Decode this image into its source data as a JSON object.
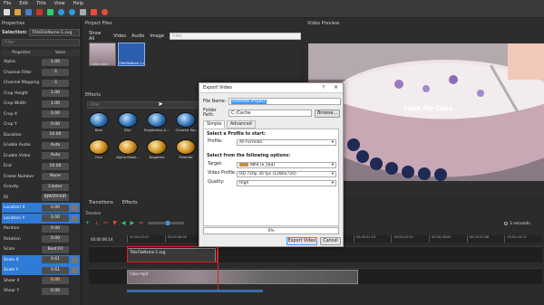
{
  "menu": [
    "File",
    "Edit",
    "Title",
    "View",
    "Help"
  ],
  "colors": {
    "accent": "#2f7bd8",
    "dialog_bg": "#ececec",
    "playhead": "#e02020"
  },
  "properties": {
    "title": "Properties",
    "selection_label": "Selection:",
    "selection_value": "TitleFileName-1.svg",
    "filter_placeholder": "Filter",
    "col_properties": "Properties",
    "col_value": "Value",
    "rows": [
      {
        "name": "Alpha",
        "value": "1.00"
      },
      {
        "name": "Channel Filter",
        "value": "-1"
      },
      {
        "name": "Channel Mapping",
        "value": "-1"
      },
      {
        "name": "Crop Height",
        "value": "1.00"
      },
      {
        "name": "Crop Width",
        "value": "1.00"
      },
      {
        "name": "Crop X",
        "value": "0.00"
      },
      {
        "name": "Crop Y",
        "value": "0.00"
      },
      {
        "name": "Duration",
        "value": "10.00"
      },
      {
        "name": "Enable Audio",
        "value": "Auto"
      },
      {
        "name": "Enable Video",
        "value": "Auto"
      },
      {
        "name": "End",
        "value": "10.00"
      },
      {
        "name": "Frame Number",
        "value": "None"
      },
      {
        "name": "Gravity",
        "value": "Center"
      },
      {
        "name": "ID",
        "value": "BJWDYOUR"
      },
      {
        "name": "Location X",
        "value": "0.00"
      },
      {
        "name": "Location Y",
        "value": "0.00"
      },
      {
        "name": "Position",
        "value": "0.00"
      },
      {
        "name": "Rotation",
        "value": "0.00"
      },
      {
        "name": "Scale",
        "value": "Best Fit"
      },
      {
        "name": "Scale X",
        "value": "0.61"
      },
      {
        "name": "Scale Y",
        "value": "0.61"
      },
      {
        "name": "Shear X",
        "value": "0.00"
      },
      {
        "name": "Shear Y",
        "value": "0.00"
      }
    ]
  },
  "project_files": {
    "title": "Project Files",
    "tabs": [
      "Show All",
      "Video",
      "Audio",
      "Image"
    ],
    "filter_placeholder": "Filter",
    "files": [
      "Cake.mp4",
      "TitleFileName-1.svg"
    ]
  },
  "effects": {
    "title": "Effects",
    "filter_placeholder": "Filter",
    "items": [
      "Bars",
      "Blur",
      "Brightness &...",
      "Chroma Key",
      "Hue",
      "Alpha Mask...",
      "Negative",
      "Pixelate"
    ]
  },
  "preview": {
    "title": "Video Preview",
    "overlay_text": "Time for Cake"
  },
  "export_dialog": {
    "title": "Export Video",
    "help": "?",
    "close": "×",
    "file_name_label": "File Name:",
    "file_name_value": "Untitled Project",
    "folder_label": "Folder Path:",
    "folder_value": "C:/Cache",
    "browse": "Browse...",
    "tab_simple": "Simple",
    "tab_advanced": "Advanced",
    "profile_section": "Select a Profile to start:",
    "profile_label": "Profile:",
    "profile_value": "All Formats",
    "options_section": "Select from the following options:",
    "target_label": "Target:",
    "target_value": "MP4 (h.264)",
    "video_profile_label": "Video Profile:",
    "video_profile_value": "HD 720p 30 fps (1280x720)",
    "quality_label": "Quality:",
    "quality_value": "High",
    "progress_text": "0%",
    "progress": 0,
    "export_btn": "Export Video",
    "cancel_btn": "Cancel"
  },
  "timeline": {
    "tab_transitions": "Transitions",
    "tab_effects": "Effects",
    "label": "Timeline",
    "timecode": "00:00:06:14",
    "zoom_text": "3 seconds",
    "ticks": [
      "00:00:03:01",
      "00:00:06:05",
      "00:00:09:09",
      "00:00:12:12",
      "00:00:15:16",
      "00:00:18:19",
      "00:00:21:23",
      "00:00:25:01",
      "00:00:28:05",
      "00:00:31:08",
      "00:00:34:12"
    ],
    "tracks": [
      {
        "name": "Track 2",
        "clip": "TitleFileName-1.svg"
      },
      {
        "name": "Track 1",
        "clip": "Cake.mp4"
      }
    ]
  }
}
